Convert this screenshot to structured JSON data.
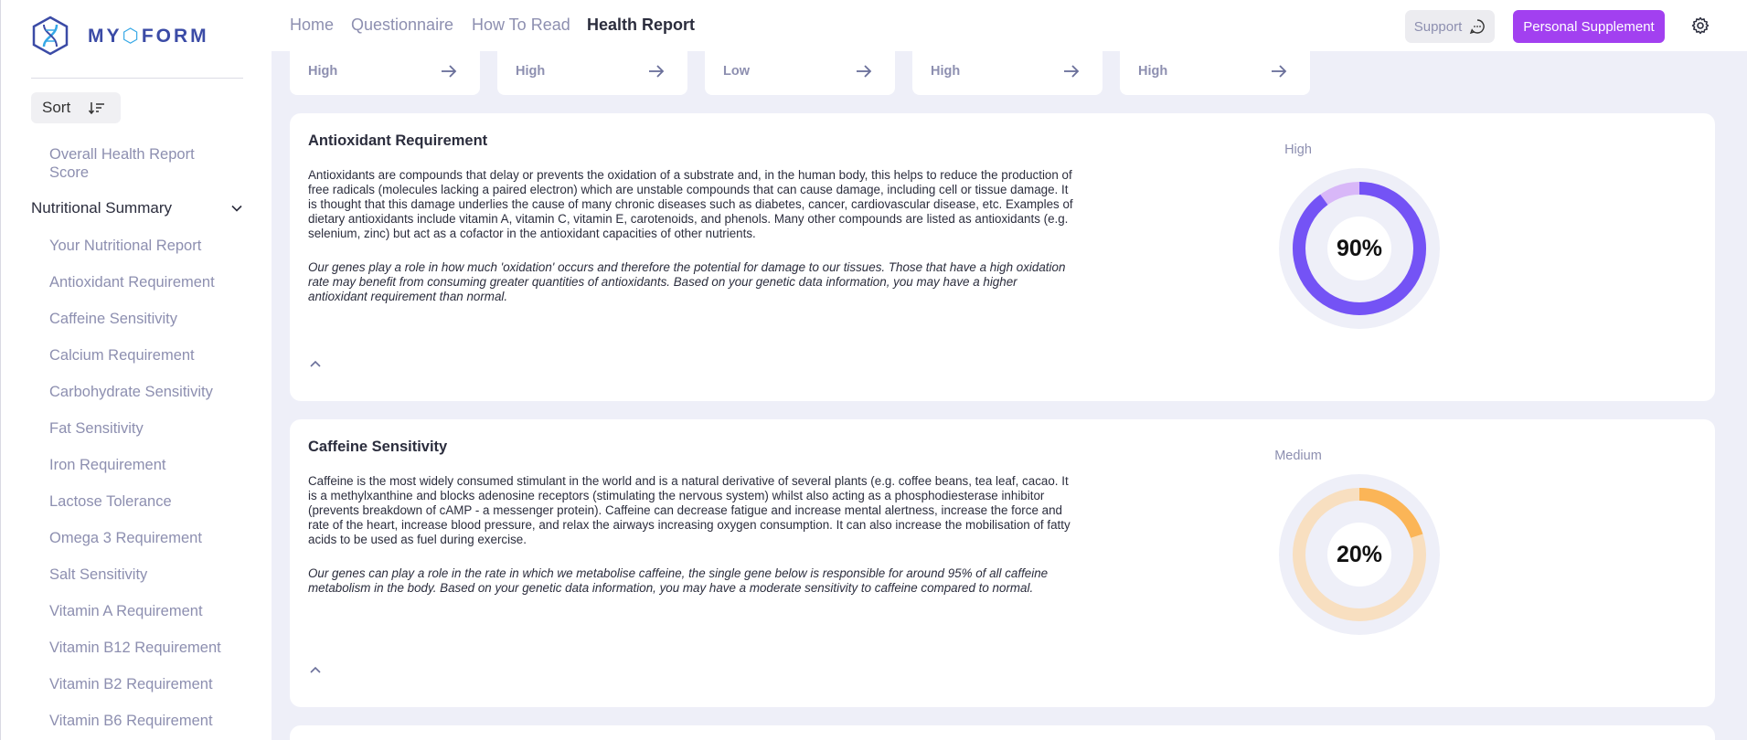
{
  "logo": {
    "text_pre": "MY",
    "text_hex": "⬡",
    "text_post": "FORM"
  },
  "nav": {
    "items": [
      {
        "label": "Home",
        "active": false
      },
      {
        "label": "Questionnaire",
        "active": false
      },
      {
        "label": "How To Read",
        "active": false
      },
      {
        "label": "Health Report",
        "active": true
      }
    ],
    "support_label": "Support",
    "supplement_label": "Personal Supplement",
    "accent_color": "#a240f0"
  },
  "sidebar": {
    "sort_label": "Sort",
    "overall_item": "Overall Health Report Score",
    "section_label": "Nutritional Summary",
    "items": [
      "Your Nutritional Report",
      "Antioxidant Requirement",
      "Caffeine Sensitivity",
      "Calcium Requirement",
      "Carbohydrate Sensitivity",
      "Fat Sensitivity",
      "Iron Requirement",
      "Lactose Tolerance",
      "Omega 3 Requirement",
      "Salt Sensitivity",
      "Vitamin A Requirement",
      "Vitamin B12 Requirement",
      "Vitamin B2 Requirement",
      "Vitamin B6 Requirement"
    ]
  },
  "top_cards": [
    "High",
    "High",
    "Low",
    "High",
    "High"
  ],
  "reports": [
    {
      "title": "Antioxidant Requirement",
      "description": "Antioxidants are compounds that delay or prevents the oxidation of a substrate and, in the human body, this helps to reduce the production of free radicals (molecules lacking a paired electron) which are unstable compounds that can cause damage, including cell or tissue damage. It is thought that this damage underlies the cause of many chronic diseases such as diabetes, cancer, cardiovascular disease, etc. Examples of dietary antioxidants include vitamin A, vitamin C, vitamin E, carotenoids, and phenols. Many other compounds are listed as antioxidants (e.g. selenium, zinc) but act as a cofactor in the antioxidant capacities of other nutrients.",
      "note": "Our genes play a role in how much 'oxidation' occurs and therefore the potential for damage to our tissues. Those that have a high oxidation rate may benefit from consuming greater quantities of antioxidants. Based on your genetic data information, you may have a higher antioxidant requirement than normal.",
      "level": "High",
      "percent_label": "90%",
      "percent": 90,
      "color": "#7453f5",
      "track_color": "#d8b7f8"
    },
    {
      "title": "Caffeine Sensitivity",
      "description": "Caffeine is the most widely consumed stimulant in the world and is a natural derivative of several plants (e.g. coffee beans, tea leaf, cacao. It is a methylxanthine and blocks adenosine receptors (stimulating the nervous system) whilst also acting as a phosphodiesterase inhibitor (prevents breakdown of cAMP - a messenger protein). Caffeine can decrease fatigue and increase mental alertness, increase the force and rate of the heart, increase blood pressure, and relax the airways increasing oxygen consumption. It can also increase the mobilisation of fatty acids to be used as fuel during exercise.",
      "note": "Our genes can play a role in the rate in which we metabolise caffeine, the single gene below is responsible for around 95% of all caffeine metabolism in the body. Based on your genetic data information, you may have a moderate sensitivity to caffeine compared to normal.",
      "level": "Medium",
      "percent_label": "20%",
      "percent": 20,
      "color": "#fbb557",
      "track_color": "#f8dfc0"
    }
  ]
}
